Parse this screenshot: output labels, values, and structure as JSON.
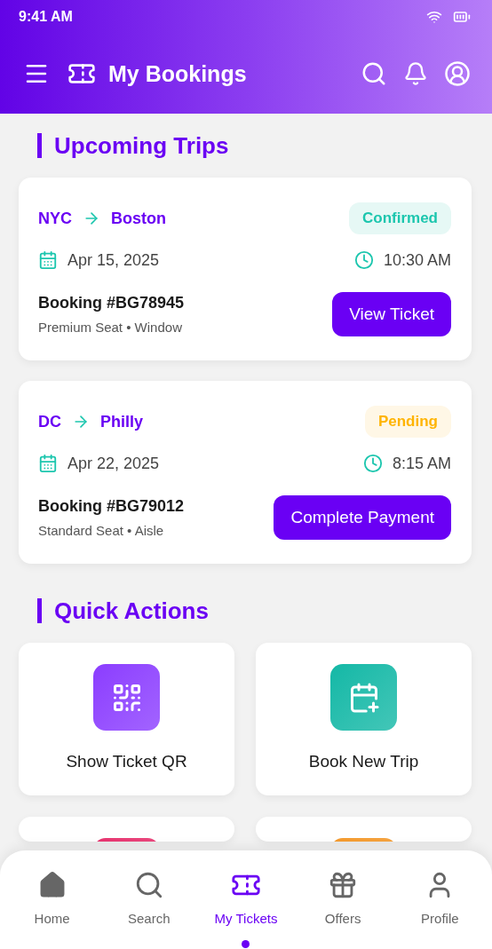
{
  "status_bar": {
    "time": "9:41 AM"
  },
  "header": {
    "title": "My Bookings"
  },
  "upcoming": {
    "title": "Upcoming Trips",
    "trips": [
      {
        "from": "NYC",
        "to": "Boston",
        "status": {
          "kind": "confirmed",
          "label": "Confirmed"
        },
        "date": "Apr 15, 2025",
        "time": "10:30 AM",
        "booking": "Booking #BG78945",
        "details": "Premium Seat • Window",
        "action": "View Ticket"
      },
      {
        "from": "DC",
        "to": "Philly",
        "status": {
          "kind": "pending",
          "label": "Pending"
        },
        "date": "Apr 22, 2025",
        "time": "8:15 AM",
        "booking": "Booking #BG79012",
        "details": "Standard Seat • Aisle",
        "action": "Complete Payment"
      }
    ]
  },
  "quick_actions": {
    "title": "Quick Actions",
    "items": [
      {
        "kind": "qr",
        "label": "Show Ticket QR",
        "color": "#8b3dff"
      },
      {
        "kind": "calendar",
        "label": "Book New Trip",
        "color": "#14b8a6"
      },
      {
        "kind": "partial",
        "color": "#e8336f"
      },
      {
        "kind": "partial",
        "color": "#f59a2c"
      }
    ]
  },
  "bottom_nav": [
    {
      "kind": "home",
      "label": "Home",
      "selected": false
    },
    {
      "kind": "search",
      "label": "Search",
      "selected": false
    },
    {
      "kind": "ticket",
      "label": "My Tickets",
      "selected": true
    },
    {
      "kind": "gift",
      "label": "Offers",
      "selected": false
    },
    {
      "kind": "user",
      "label": "Profile",
      "selected": false
    }
  ]
}
